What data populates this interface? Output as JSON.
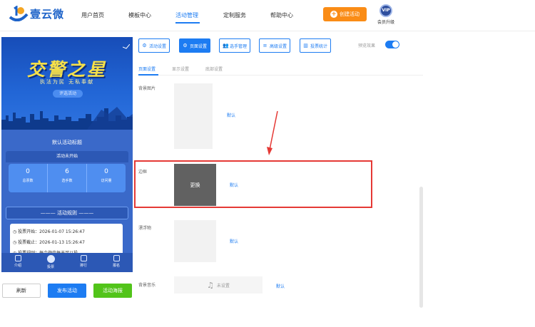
{
  "header": {
    "logo_text": "壹云微",
    "nav": [
      "用户首页",
      "模板中心",
      "活动管理",
      "定制服务",
      "帮助中心"
    ],
    "active_nav": "活动管理",
    "create_button": "创建活动",
    "vip_badge": "VIP",
    "vip_label": "会员升级"
  },
  "preview": {
    "banner_title": "交警之星",
    "banner_subtitle": "执法为民 无私奉献",
    "banner_tag": "评选活动",
    "event_title": "默认活动标题",
    "status": "活动未开始",
    "stats": [
      {
        "value": "0",
        "label": "总票数"
      },
      {
        "value": "6",
        "label": "选手数"
      },
      {
        "value": "0",
        "label": "访问量"
      }
    ],
    "rules_title": "活动规则",
    "rules": [
      "投票开始：2026-01-07 15:26:47",
      "投票截止：2026-01-13 15:26:47",
      "投票规则：每个微信每天可以投 ..."
    ],
    "tabs": [
      "介绍",
      "投票",
      "排行",
      "报名"
    ]
  },
  "actions": {
    "refresh": "刷新",
    "publish": "发布活动",
    "poster": "活动海报"
  },
  "toolbar": {
    "buttons": [
      "活动设置",
      "页面设置",
      "选手管理",
      "高级设置",
      "投票统计"
    ],
    "active": "页面设置",
    "preview_label": "预览效果",
    "preview_on": true
  },
  "subtabs": {
    "items": [
      "页面设置",
      "显示设置",
      "底部设置"
    ],
    "active": "页面设置"
  },
  "settings": {
    "background_label": "背景图片",
    "background_link": "默认",
    "frame_label": "边框",
    "frame_button": "更换",
    "frame_link": "默认",
    "float_label": "漂浮物",
    "float_link": "默认",
    "music_label": "背景音乐",
    "music_value": "未设置",
    "music_link": "默认"
  },
  "colors": {
    "primary": "#1d7cf2",
    "orange": "#fa8c16",
    "green": "#52c41a",
    "highlight": "#e53935"
  }
}
